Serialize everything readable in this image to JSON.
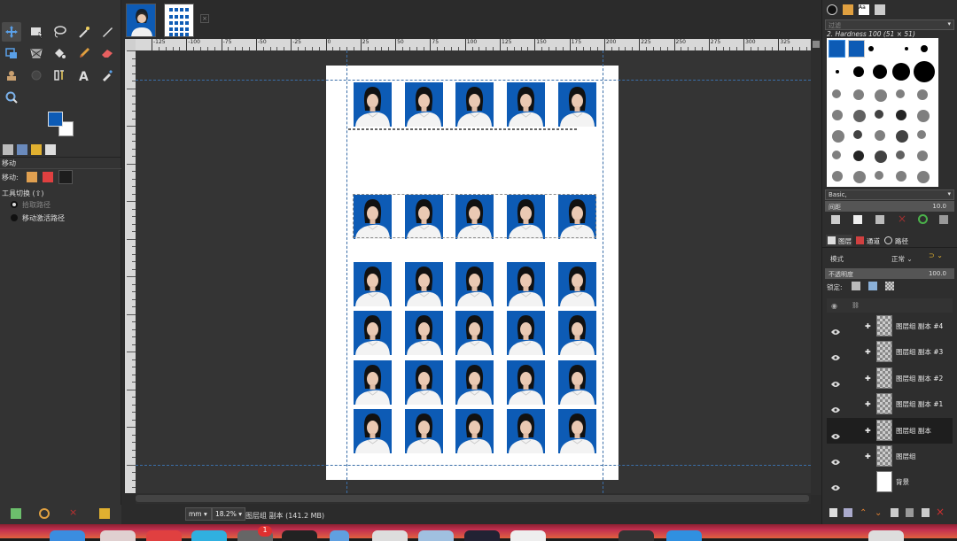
{
  "toolbox": {
    "tools": [
      {
        "name": "move-tool-icon"
      },
      {
        "name": "rect-select-tool-icon"
      },
      {
        "name": "lasso-tool-icon"
      },
      {
        "name": "fuzzy-select-tool-icon"
      },
      {
        "name": "paths-tool-icon"
      },
      {
        "name": "transform-tool-icon"
      },
      {
        "name": "perspective-tool-icon"
      },
      {
        "name": "bucket-fill-tool-icon"
      },
      {
        "name": "paintbrush-tool-icon"
      },
      {
        "name": "eraser-tool-icon"
      },
      {
        "name": "clone-tool-icon"
      },
      {
        "name": "smudge-tool-icon"
      },
      {
        "name": "warp-tool-icon"
      },
      {
        "name": "text-tool-icon"
      },
      {
        "name": "color-picker-tool-icon"
      },
      {
        "name": "zoom-tool-icon"
      }
    ],
    "fg_color": "#0d5bb5",
    "bg_color": "#ffffff"
  },
  "tool_options": {
    "title": "移动",
    "move_label": "移动:",
    "toggle_label": "工具切换 (⇧)",
    "radio1": "拾取路径",
    "radio2": "移动激活路径"
  },
  "ruler": {
    "ticks": [
      "-125",
      "-100",
      "-75",
      "-50",
      "-25",
      "0",
      "25",
      "50",
      "75",
      "100",
      "125",
      "150",
      "175",
      "200",
      "225",
      "250",
      "275",
      "300",
      "325"
    ]
  },
  "status": {
    "unit": "mm",
    "zoom": "18.2%",
    "layer_info": "图层组 副本 (141.2 MB)"
  },
  "right_panel": {
    "filter_placeholder": "过滤",
    "brush_name": "2. Hardness 100 (51 × 51)",
    "brush_set": "Basic,",
    "spacing_label": "间距",
    "spacing_value": "10.0",
    "tabs": [
      "图层",
      "通道",
      "路径"
    ],
    "mode_label": "模式",
    "mode_value": "正常",
    "opacity_label": "不透明度",
    "opacity_value": "100.0",
    "lock_label": "锁定:",
    "layers": [
      {
        "name": "图层组 副本 #4",
        "selected": false
      },
      {
        "name": "图层组 副本 #3",
        "selected": false
      },
      {
        "name": "图层组 副本 #2",
        "selected": false
      },
      {
        "name": "图层组 副本 #1",
        "selected": false
      },
      {
        "name": "图层组 副本",
        "selected": true
      },
      {
        "name": "图层组",
        "selected": false
      },
      {
        "name": "背景",
        "selected": false
      }
    ]
  },
  "canvas": {
    "page_color": "#ffffff",
    "photo_bg": "#0d5bb5",
    "rows": 6,
    "cols": 5
  }
}
